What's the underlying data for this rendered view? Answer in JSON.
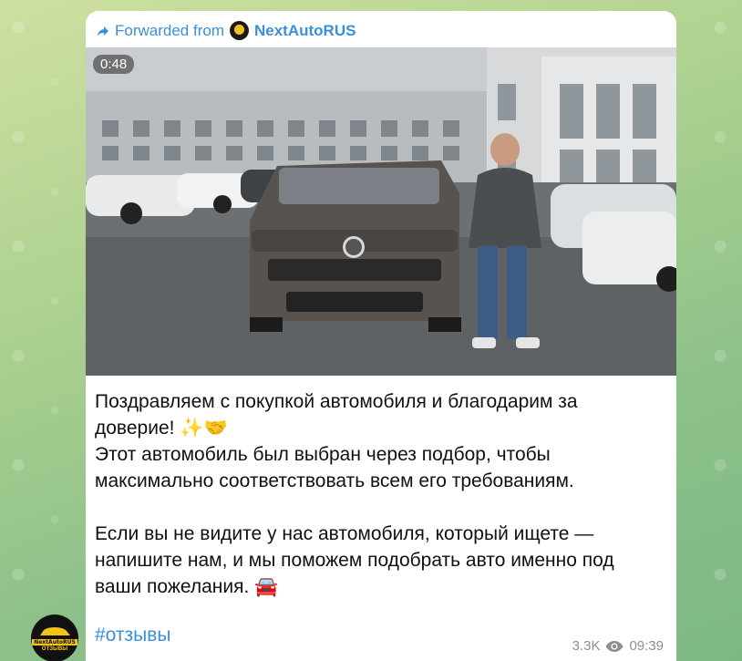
{
  "forward": {
    "prefix": "Forwarded from",
    "channel": "NextAutoRUS"
  },
  "video": {
    "duration": "0:48"
  },
  "message": {
    "line1": "Поздравляем с покупкой автомобиля и благодарим за",
    "line2": "доверие! ✨🤝",
    "line3": "Этот автомобиль был выбран через подбор, чтобы",
    "line4": "максимально соответствовать всем его требованиям.",
    "line5": "Если вы не видите у нас автомобиля, который ищете —",
    "line6": "напишите нам, и мы поможем подобрать авто именно под",
    "line7": "ваши пожелания. 🚘"
  },
  "hashtag": "#отзывы",
  "meta": {
    "views": "3.3K",
    "time": "09:39"
  },
  "avatar": {
    "brand": "NextAutoRUS",
    "sub": "ОТЗЫВЫ"
  },
  "colors": {
    "link": "#3a8fd8",
    "meta": "#8a8f94",
    "accent_yellow": "#f2c419"
  }
}
